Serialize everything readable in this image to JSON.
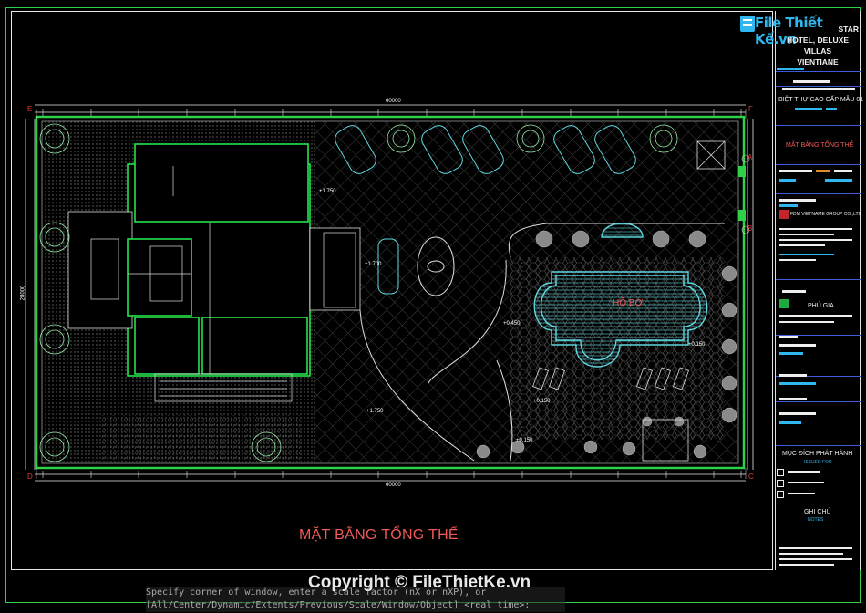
{
  "logo": {
    "text": "File Thiết Kế.vn"
  },
  "project": {
    "name": "STAR HOTEL, DELUXE VILLAS VIENTIANE",
    "line1": "STAR",
    "line2": "HOTEL, DELUXE VILLAS",
    "line3": "VIENTIANE"
  },
  "sheet": {
    "title": "BIỆT THỰ CAO CẤP MẪU 01",
    "drawing_name": "MẶT BẰNG TỔNG THỂ",
    "company": "FDM VIETNAME GROUP CO.,LTD",
    "phu_gia": "PHÚ GIA",
    "issue_heading": "MỤC ĐÍCH PHÁT HÀNH",
    "issue_sub": "ISSUED FOR",
    "notes_heading": "GHI CHÚ",
    "notes_sub": "NOTES"
  },
  "plan": {
    "title": "MẶT BẰNG TỔNG THỂ",
    "pool_label": "HỒ BƠI",
    "top_dimension": "60000",
    "bottom_dimension": "60000",
    "left_dimension": "28000",
    "grid": {
      "E": "E",
      "F": "F",
      "A": "A",
      "B": "B",
      "C": "C",
      "D": "D"
    },
    "levels": [
      "+1.750",
      "+1.700",
      "+0.450",
      "+1.750",
      "+0.150",
      "+0.150",
      "+0.150"
    ]
  },
  "command_line": {
    "line1": "Specify corner of window, enter a scale factor (nX or nXP), or",
    "line2": "[All/Center/Dynamic/Extents/Previous/Scale/Window/Object] <real time>:"
  },
  "watermark": {
    "text": "Copyright © FileThietKe.vn"
  },
  "colors": {
    "frame": "#2fd14a",
    "dimension": "#e8e8e8",
    "pool": "#5fd6e0",
    "walls": "#22e34a",
    "red_text": "#ef5a5a",
    "title_block_lines": "#3b5bd8"
  }
}
